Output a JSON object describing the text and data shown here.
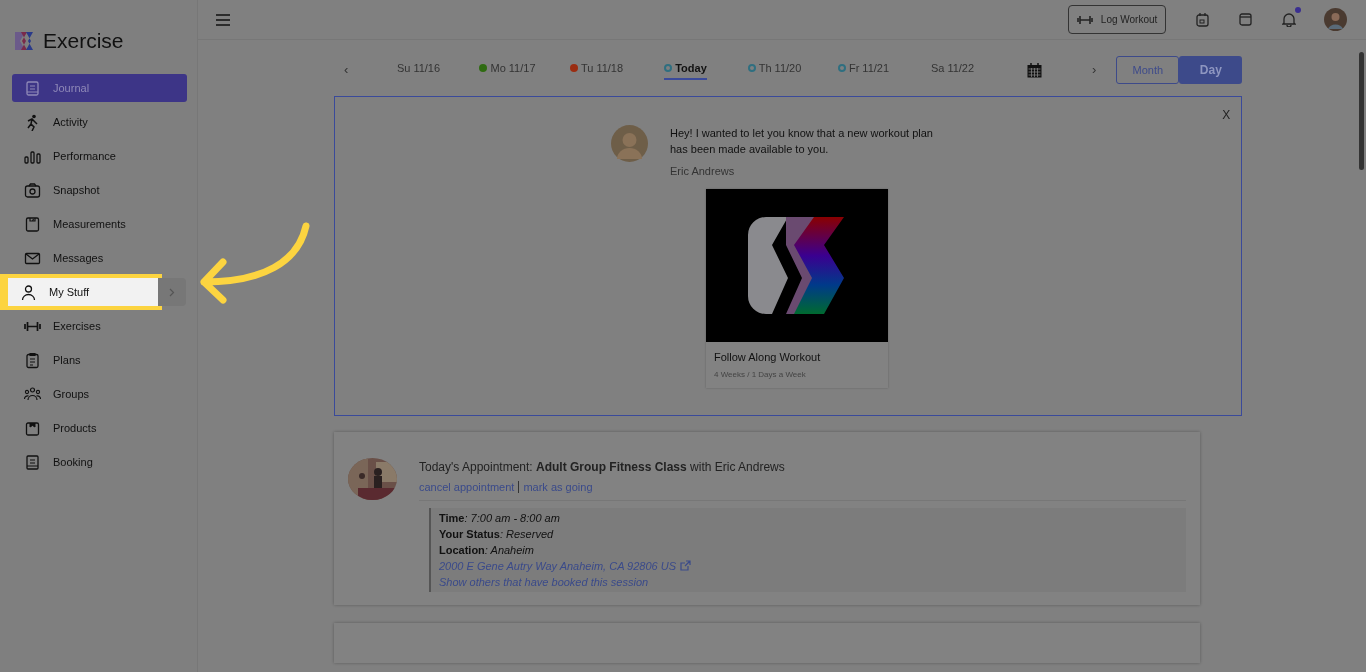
{
  "app": {
    "name": "Exercise"
  },
  "sidebar": {
    "items": [
      {
        "label": "Journal",
        "selected": true,
        "highlighted": false,
        "expandable": false
      },
      {
        "label": "Activity",
        "selected": false,
        "highlighted": false,
        "expandable": false
      },
      {
        "label": "Performance",
        "selected": false,
        "highlighted": false,
        "expandable": false
      },
      {
        "label": "Snapshot",
        "selected": false,
        "highlighted": false,
        "expandable": false
      },
      {
        "label": "Measurements",
        "selected": false,
        "highlighted": false,
        "expandable": false
      },
      {
        "label": "Messages",
        "selected": false,
        "highlighted": false,
        "expandable": false
      },
      {
        "label": "My Stuff",
        "selected": false,
        "highlighted": true,
        "expandable": true
      },
      {
        "label": "Exercises",
        "selected": false,
        "highlighted": false,
        "expandable": false
      },
      {
        "label": "Plans",
        "selected": false,
        "highlighted": false,
        "expandable": false
      },
      {
        "label": "Groups",
        "selected": false,
        "highlighted": false,
        "expandable": false
      },
      {
        "label": "Products",
        "selected": false,
        "highlighted": false,
        "expandable": false
      },
      {
        "label": "Booking",
        "selected": false,
        "highlighted": false,
        "expandable": false
      }
    ]
  },
  "topbar": {
    "log_button": "Log Workout",
    "notification_unread": true
  },
  "days": [
    {
      "label": "Su 11/16",
      "selected": false
    },
    {
      "label": "Mo 11/17",
      "dot_filled": true,
      "color": "#2f6b12",
      "selected": false
    },
    {
      "label": "Tu 11/18",
      "dot_filled": true,
      "color": "#9a2d12",
      "selected": false
    },
    {
      "label": "Today",
      "dot_filled": false,
      "color": "#2f6f80",
      "selected": true
    },
    {
      "label": "Th 11/20",
      "dot_filled": false,
      "color": "#2f6f80",
      "selected": false
    },
    {
      "label": "Fr 11/21",
      "dot_filled": false,
      "color": "#2f6f80",
      "selected": false
    },
    {
      "label": "Sa 11/22",
      "selected": false
    }
  ],
  "day_nav": {
    "previous": "‹",
    "next": "›"
  },
  "view_toggle": [
    {
      "label": "Month",
      "selected": false
    },
    {
      "label": "Day",
      "selected": true
    }
  ],
  "message": {
    "close": "X",
    "text": "Hey! I wanted to let you know that a new workout plan has been made available to you.",
    "sender": "Eric Andrews",
    "plan": {
      "title": "Follow Along Workout",
      "subtitle": "4 Weeks / 1 Days a Week"
    }
  },
  "appointment": {
    "prefix": "Today's Appointment: **Adult Group Fitness Class** with Eric Andrews",
    "actions": [
      "cancel appointment",
      "mark as going"
    ],
    "details": [
      {
        "label": "Time",
        "value": ": 7:00 am - 8:00 am"
      },
      {
        "label": "Your Status",
        "value": ": Reserved"
      },
      {
        "label": "Location",
        "value": ": Anaheim"
      }
    ],
    "address": "2000 E Gene Autry Way Anaheim, CA 92806 US",
    "others_link": "Show others that have booked this session"
  }
}
